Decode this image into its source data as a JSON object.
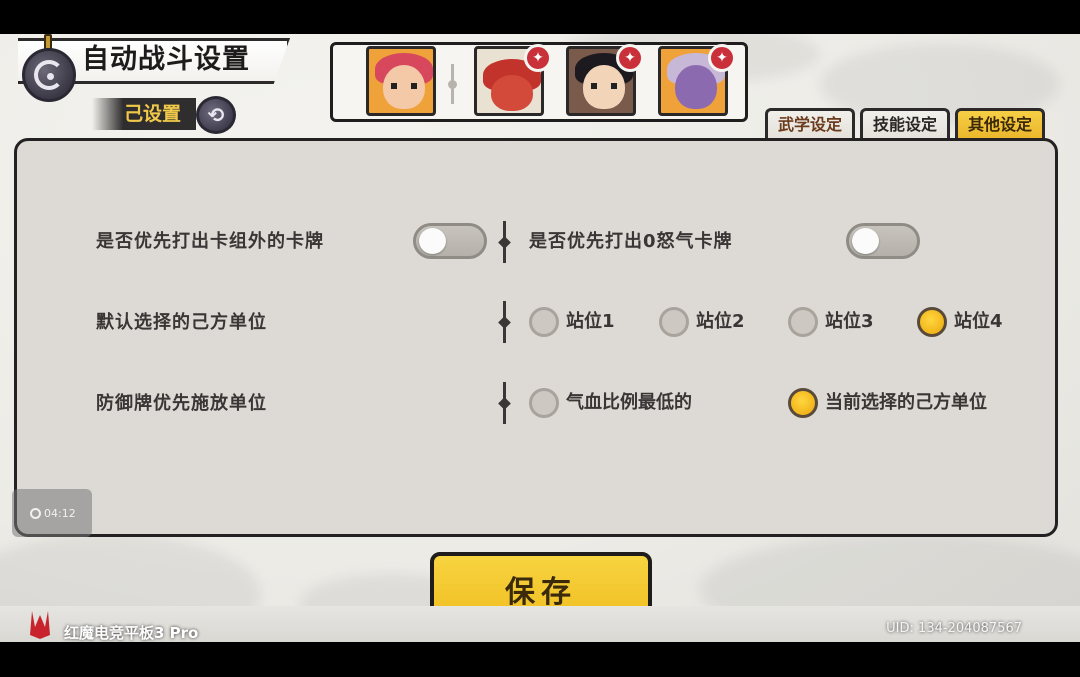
{
  "header": {
    "title": "自动战斗设置",
    "preset_label": "己设置"
  },
  "tabs": [
    {
      "label": "武学设定",
      "active": false
    },
    {
      "label": "技能设定",
      "active": false
    },
    {
      "label": "其他设定",
      "active": true
    }
  ],
  "settings": {
    "row1": {
      "left_label": "是否优先打出卡组外的卡牌",
      "left_toggle": "off",
      "right_label": "是否优先打出0怒气卡牌",
      "right_toggle": "off"
    },
    "row2": {
      "label": "默认选择的己方单位",
      "options": [
        "站位1",
        "站位2",
        "站位3",
        "站位4"
      ],
      "selected": "站位4"
    },
    "row3": {
      "label": "防御牌优先施放单位",
      "options": [
        "气血比例最低的",
        "当前选择的己方单位"
      ],
      "selected": "当前选择的己方单位"
    }
  },
  "clock": {
    "time": "04:12"
  },
  "save_label": "保存",
  "footer": {
    "device": "红魔电竞平板3 Pro",
    "uid": "UID:  134-204087567"
  },
  "colors": {
    "accent": "#f0be20",
    "panel": "#ddd9d4",
    "text": "#3a3636"
  }
}
